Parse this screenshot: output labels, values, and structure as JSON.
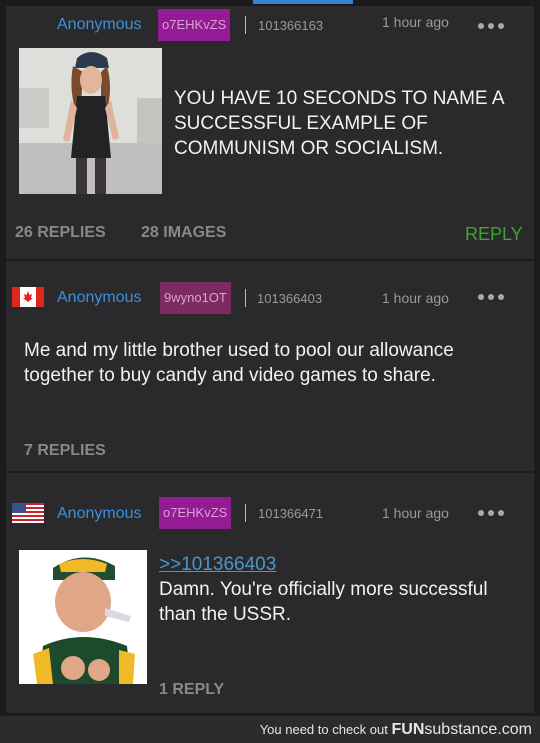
{
  "posts": [
    {
      "name": "Anonymous",
      "poster_id": "o7EHKvZS",
      "post_number": "101366163",
      "time": "1 hour ago",
      "text": "YOU HAVE 10 SECONDS TO NAME A SUCCESSFUL EXAMPLE OF COMMUNISM OR SOCIALISM.",
      "replies": "26 REPLIES",
      "images": "28 IMAGES",
      "reply_action": "REPLY"
    },
    {
      "flag": "canada-flag",
      "name": "Anonymous",
      "poster_id": "9wyno1OT",
      "post_number": "101366403",
      "time": "1 hour ago",
      "text": "Me and my little brother used to pool our allowance together to buy candy and video games to share.",
      "replies": "7 REPLIES"
    },
    {
      "flag": "usa-flag",
      "name": "Anonymous",
      "poster_id": "o7EHKvZS",
      "post_number": "101366471",
      "time": "1 hour ago",
      "quote": ">>101366403",
      "text": "Damn. You're officially more successful than the USSR.",
      "replies": "1 REPLY"
    }
  ],
  "footer": {
    "prefix": "You need to check out",
    "brand": "FUN",
    "brand_sub": "substance.com"
  },
  "colors": {
    "background": "#1b1b1d",
    "card": "#2a2a2c",
    "name": "#3d8fdc",
    "reply": "#3fa336",
    "poster_id_magenta": "#941b93",
    "poster_id_plum": "#7d2a60"
  },
  "icons": [
    "more-options-icon",
    "canada-flag-icon",
    "usa-flag-icon"
  ]
}
